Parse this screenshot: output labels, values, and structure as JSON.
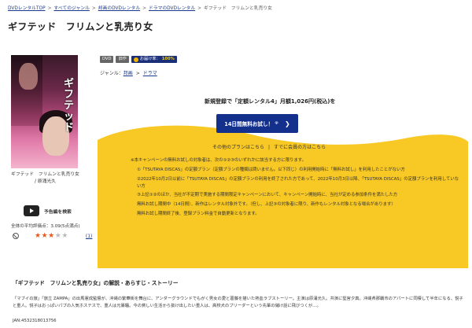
{
  "breadcrumb": {
    "items": [
      "DVDレンタルTOP",
      "すべてのジャンル",
      "邦画のDVDレンタル",
      "ドラマのDVDレンタル"
    ],
    "separator": ">",
    "current": "ギフテッド　フリムンと乳売り女"
  },
  "title": "ギフテッド　フリムンと乳売り女",
  "jacket": {
    "title_art": "ギフテッド",
    "caption_title": "ギフテッド　フリムンと乳売り女",
    "caption_cast": "/ 原涌光久"
  },
  "trailer": {
    "label": "予告編を検索"
  },
  "rating": {
    "summary": "全体の平均評価点：",
    "score_text": "3.09(5点満点)",
    "stars_filled": 3,
    "stars_total": 5,
    "review_count": "(1)"
  },
  "badges": {
    "format": "DVD",
    "old": "旧作",
    "point_label": "お届け率：",
    "point_value": "100%"
  },
  "genre": {
    "label": "ジャンル：",
    "items": [
      "邦画",
      "ドラマ"
    ],
    "separator": ">"
  },
  "promo": {
    "headline": "新規登録で「定額レンタル4」月額1,026円(税込)を",
    "cta": "14日間無料お試し！",
    "cta_ext": "※",
    "links": [
      "その他のプランはこちら",
      "すでに会員の方はこちら"
    ],
    "link_sep": "|"
  },
  "notes": {
    "intro": "※本キャンペーンの無料お試しの対象者は、次の①②③のいずれかに該当する方に限ります。",
    "items": [
      "①「TSUTAYA DISCAS」の定額プラン（定額プランの種類は問いません。以下同じ）の利用開始時に「無料お試し」を利用したことがない方",
      "②2022年10月2日以前に「TSUTAYA DISCAS」の定額プランの利用を終了された方であって、2022年10月3日以降、「TSUTAYA DISCAS」の定額プランを利用していない方",
      "③上記①②のほか、当社が不定期で実施する期間限定キャンペーンにおいて、キャンペーン開始時に、当社が定める参加条件を満たした方"
    ],
    "trial_info": "無料お試し期間中（14日間）、新作はレンタル対象外です。（但し、上記③の対象者に限り、新作もレンタル対象となる場合があります）",
    "after_info": "無料お試し期間終了後、登録プラン料金で自動更新となります。"
  },
  "story": {
    "title": "「ギフテッド　フリムンと乳売り女」の解説・あらすじ・ストーリー",
    "body": "「マブイの旅」「旅立 ZAMPA」の出馬憲成監督が、沖縄の繁華街を舞台に、アンダーグラウンドでもがく男女の愛と葛藤を描いた熱血ラブストーリー。主演は原涌光久。共演に堅宮夕真。沖縄県那覇市のアパートに同棲して半年になる、悦子と重人。悦子はおっぱいパブの人気ホステスで、重人は元暴騒。今の貧しい生活から抜け出したい重人は、高校犬のブリーダーという先輩の儲け話に飛びつくが…。",
    "jan": "JAN:4532318013756"
  },
  "colors": {
    "brand_navy": "#13308d",
    "promo_yellow": "#f8c825",
    "star": "#e85a1a",
    "link": "#1a3a8f"
  }
}
